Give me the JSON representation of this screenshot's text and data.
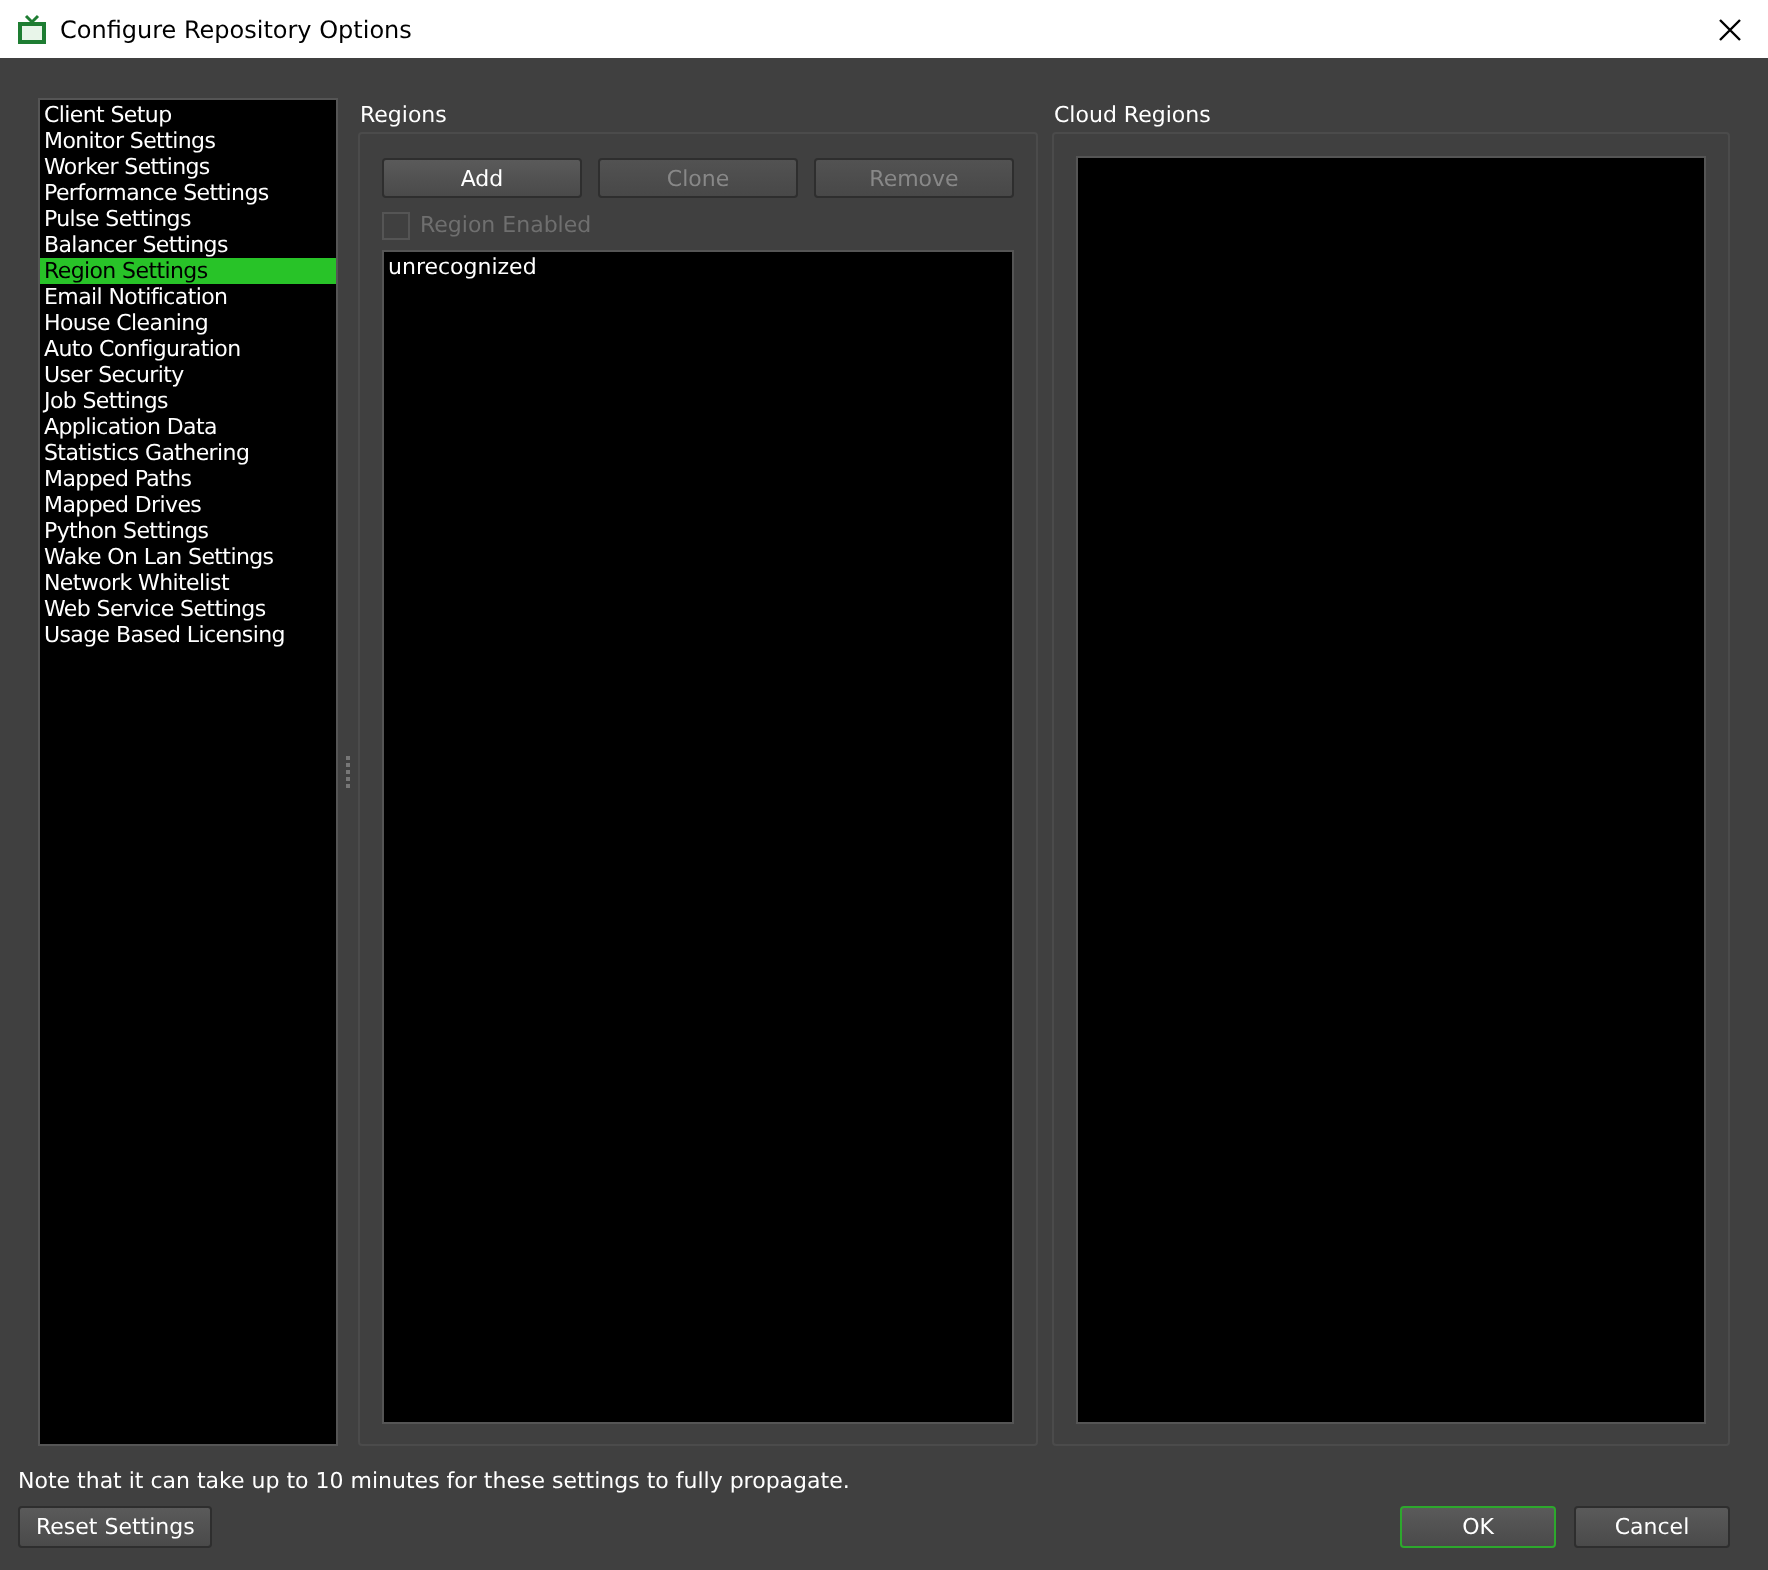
{
  "window": {
    "title": "Configure Repository Options"
  },
  "sidebar": {
    "items": [
      {
        "label": "Client Setup",
        "selected": false
      },
      {
        "label": "Monitor Settings",
        "selected": false
      },
      {
        "label": "Worker Settings",
        "selected": false
      },
      {
        "label": "Performance Settings",
        "selected": false
      },
      {
        "label": "Pulse Settings",
        "selected": false
      },
      {
        "label": "Balancer Settings",
        "selected": false
      },
      {
        "label": "Region Settings",
        "selected": true
      },
      {
        "label": "Email Notification",
        "selected": false
      },
      {
        "label": "House Cleaning",
        "selected": false
      },
      {
        "label": "Auto Configuration",
        "selected": false
      },
      {
        "label": "User Security",
        "selected": false
      },
      {
        "label": "Job Settings",
        "selected": false
      },
      {
        "label": "Application Data",
        "selected": false
      },
      {
        "label": "Statistics Gathering",
        "selected": false
      },
      {
        "label": "Mapped Paths",
        "selected": false
      },
      {
        "label": "Mapped Drives",
        "selected": false
      },
      {
        "label": "Python Settings",
        "selected": false
      },
      {
        "label": "Wake On Lan Settings",
        "selected": false
      },
      {
        "label": "Network Whitelist",
        "selected": false
      },
      {
        "label": "Web Service Settings",
        "selected": false
      },
      {
        "label": "Usage Based Licensing",
        "selected": false
      }
    ]
  },
  "regions": {
    "title": "Regions",
    "buttons": [
      {
        "label": "Add",
        "disabled": false
      },
      {
        "label": "Clone",
        "disabled": true
      },
      {
        "label": "Remove",
        "disabled": true
      }
    ],
    "region_enabled": {
      "label": "Region Enabled",
      "checked": false,
      "disabled": true
    },
    "list": [
      {
        "label": "unrecognized",
        "selected": false
      }
    ]
  },
  "cloud_regions": {
    "title": "Cloud Regions"
  },
  "note": "Note that it can take up to 10 minutes for these settings to fully propagate.",
  "footer": {
    "reset": "Reset Settings",
    "ok": {
      "label": "OK",
      "default": true
    },
    "cancel": {
      "label": "Cancel",
      "default": false
    }
  }
}
